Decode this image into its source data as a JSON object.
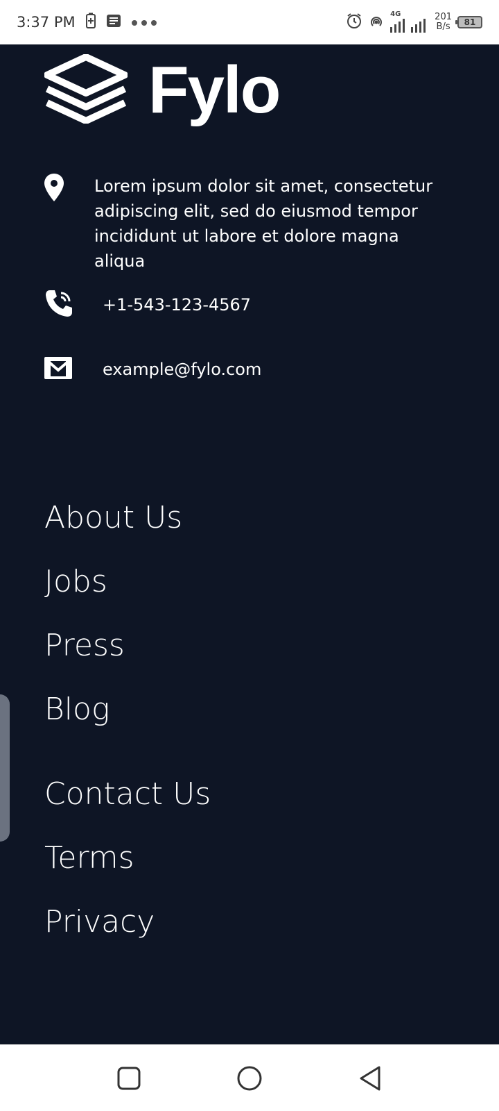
{
  "status_bar": {
    "time": "3:37 PM",
    "net_speed_value": "201",
    "net_speed_unit": "B/s",
    "network_type": "4G",
    "battery_level": "81",
    "icons": [
      "battery-saver-icon",
      "message-icon",
      "more-dots-icon",
      "alarm-icon",
      "hotspot-icon",
      "signal-icon"
    ]
  },
  "footer": {
    "logo_text": "Fylo",
    "address": "Lorem ipsum dolor sit amet, consectetur adipiscing elit, sed do eiusmod tempor incididunt ut labore et dolore magna aliqua",
    "phone": "+1-543-123-4567",
    "email": "example@fylo.com",
    "links_primary": [
      "About Us",
      "Jobs",
      "Press",
      "Blog"
    ],
    "links_secondary": [
      "Contact Us",
      "Terms",
      "Privacy"
    ]
  },
  "navigation_bar": {
    "buttons": [
      "recent-apps",
      "home",
      "back"
    ]
  },
  "colors": {
    "footer_bg": "#0e1525",
    "text": "#ffffff",
    "system_bar_bg": "#ffffff"
  }
}
